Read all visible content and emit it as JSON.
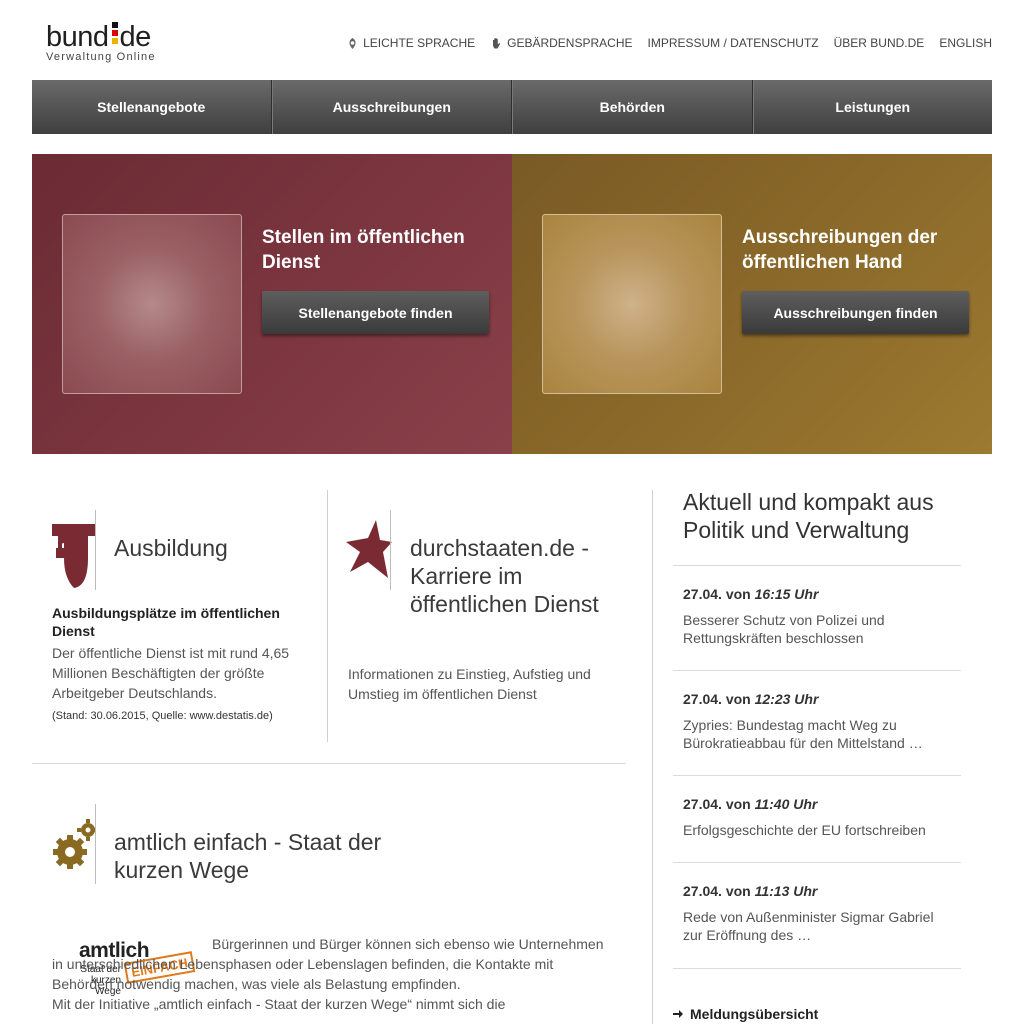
{
  "header": {
    "logo_main_left": "bund",
    "logo_main_right": "de",
    "logo_sub": "Verwaltung Online",
    "meta_links": [
      {
        "label": "LEICHTE SPRACHE",
        "icon": "leichte-sprache-icon"
      },
      {
        "label": "GEBÄRDENSPRACHE",
        "icon": "hand-icon"
      },
      {
        "label": "IMPRESSUM / DATENSCHUTZ"
      },
      {
        "label": "ÜBER BUND.DE"
      },
      {
        "label": "ENGLISH"
      }
    ]
  },
  "main_nav": [
    "Stellenangebote",
    "Ausschreibungen",
    "Behörden",
    "Leistungen"
  ],
  "hero": [
    {
      "title": "Stellen im öffentlichen Dienst",
      "button": "Stellenangebote finden",
      "color": "#7c3640"
    },
    {
      "title": "Ausschreibungen der öffentlichen Hand",
      "button": "Ausschreibungen finden",
      "color": "#8c6a2a"
    }
  ],
  "teasers": {
    "ausbildung": {
      "title": "Ausbildung",
      "subtitle": "Ausbildungsplätze im öffentlichen Dienst",
      "text": "Der öffentliche Dienst ist mit rund 4,65 Millionen Beschäftigten der größte Arbeitgeber Deutschlands.",
      "note": "(Stand: 30.06.2015, Quelle: www.destatis.de)",
      "icon": "graduation-cap-icon"
    },
    "durchstaaten": {
      "title": "durchstaaten.de - Karriere im öffentlichen Dienst",
      "text": "Informationen zu Einstieg, Aufstieg und Umstieg im öffentlichen Dienst",
      "icon": "star-icon"
    },
    "amtlich": {
      "title": "amtlich einfach - Staat der kurzen Wege",
      "logo_word": "amtlich",
      "logo_sub1": "Staat der",
      "logo_sub2": "kurzen Wege",
      "logo_stamp": "EINFACH",
      "text": "Bürgerinnen und Bürger können sich ebenso wie Unternehmen in unterschiedlichen Lebensphasen oder Lebenslagen befinden, die Kontakte mit Behörden notwendig machen, was viele als Belastung empfinden.",
      "text2": "Mit der Initiative „amtlich einfach - Staat der kurzen Wege“ nimmt sich die",
      "icon": "gears-icon"
    }
  },
  "news": {
    "title": "Aktuell und kompakt aus Politik und Verwaltung",
    "items": [
      {
        "date": "27.04.",
        "von": "von",
        "time": "16:15 Uhr",
        "text": "Besserer Schutz von Polizei und Rettungskräften beschlossen"
      },
      {
        "date": "27.04.",
        "von": "von",
        "time": "12:23 Uhr",
        "text": "Zypries: Bundestag macht Weg zu Bürokratieabbau für den Mittelstand …"
      },
      {
        "date": "27.04.",
        "von": "von",
        "time": "11:40 Uhr",
        "text": "Erfolgsgeschichte der EU fortschreiben"
      },
      {
        "date": "27.04.",
        "von": "von",
        "time": "11:13 Uhr",
        "text": "Rede von Außenminister Sigmar Gabriel zur Eröffnung des …"
      }
    ],
    "more": "Meldungsübersicht"
  },
  "colors": {
    "accent_red": "#7a2a33",
    "accent_gold": "#8a6a22",
    "nav_dark": "#4a4a4a"
  }
}
